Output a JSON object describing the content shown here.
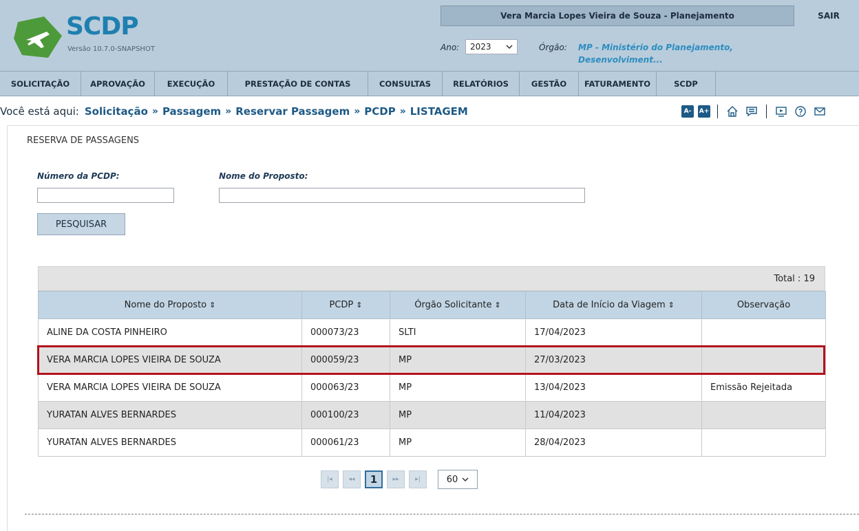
{
  "header": {
    "logo_title": "SCDP",
    "logo_version": "Versão 10.7.0-SNAPSHOT",
    "user_label": "Vera Marcia Lopes Vieira de Souza - Planejamento",
    "logout_label": "SAIR",
    "ano_label": "Ano:",
    "ano_value": "2023",
    "orgao_label": "Órgão:",
    "orgao_value": "MP - Ministério do Planejamento, Desenvolviment..."
  },
  "nav": {
    "items": [
      "SOLICITAÇÃO",
      "APROVAÇÃO",
      "EXECUÇÃO",
      "PRESTAÇÃO DE CONTAS",
      "CONSULTAS",
      "RELATÓRIOS",
      "GESTÃO",
      "FATURAMENTO",
      "SCDP"
    ]
  },
  "breadcrumb": {
    "prefix": "Você está aqui:",
    "items": [
      "Solicitação",
      "Passagem",
      "Reservar Passagem",
      "PCDP",
      "LISTAGEM"
    ]
  },
  "tools": {
    "font_decrease": "A-",
    "font_increase": "A+"
  },
  "form": {
    "section_title": "RESERVA DE PASSAGENS",
    "pcdp_label": "Número da PCDP:",
    "pcdp_value": "",
    "proposto_label": "Nome do Proposto:",
    "proposto_value": "",
    "search_button": "PESQUISAR"
  },
  "table": {
    "total_label": "Total : 19",
    "columns": [
      "Nome do Proposto",
      "PCDP",
      "Órgão Solicitante",
      "Data de Início da Viagem",
      "Observação"
    ],
    "rows": [
      [
        "ALINE DA COSTA PINHEIRO",
        "000073/23",
        "SLTI",
        "17/04/2023",
        ""
      ],
      [
        "VERA MARCIA LOPES VIEIRA DE SOUZA",
        "000059/23",
        "MP",
        "27/03/2023",
        ""
      ],
      [
        "VERA MARCIA LOPES VIEIRA DE SOUZA",
        "000063/23",
        "MP",
        "13/04/2023",
        "Emissão Rejeitada"
      ],
      [
        "YURATAN ALVES BERNARDES",
        "000100/23",
        "MP",
        "11/04/2023",
        ""
      ],
      [
        "YURATAN ALVES BERNARDES",
        "000061/23",
        "MP",
        "28/04/2023",
        ""
      ]
    ],
    "highlighted_row": 1
  },
  "pagination": {
    "current_page": "1",
    "per_page": "60"
  },
  "colors": {
    "header_bg": "#b9ccdb",
    "link_blue": "#1e5a86",
    "highlight_border": "#b3121a"
  }
}
